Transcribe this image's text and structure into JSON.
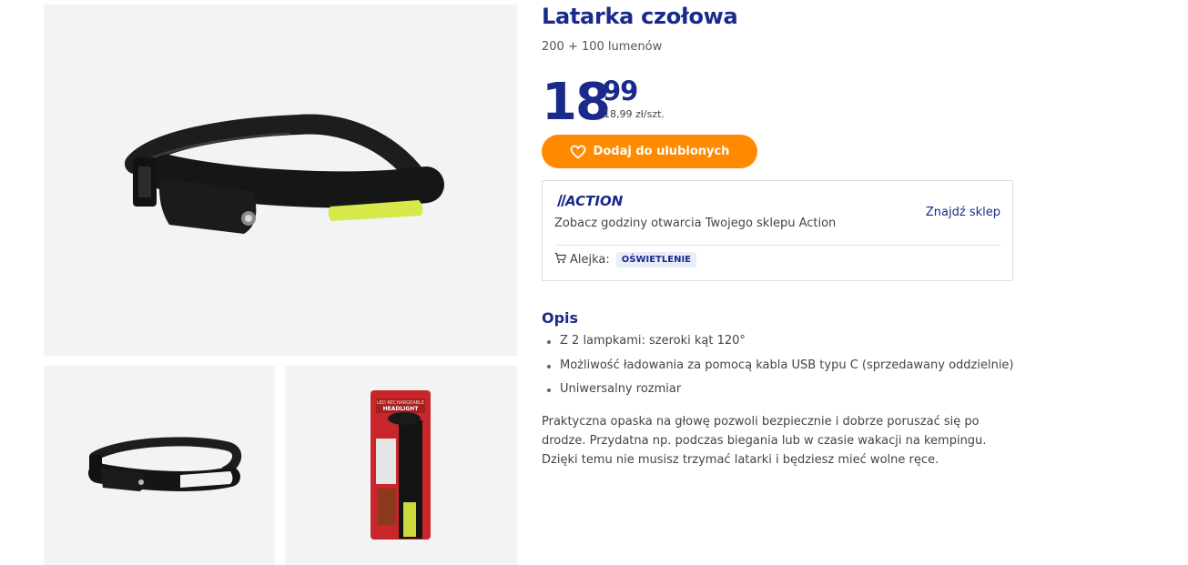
{
  "product": {
    "title": "Latarka czołowa",
    "subtitle": "200 + 100 lumenów",
    "price_int": "18",
    "price_dec": "99",
    "unit_price": "18,99 zł/szt.",
    "favorite_label": "Dodaj do ulubionych"
  },
  "store": {
    "logo_text": "ACTION",
    "text": "Zobacz godziny otwarcia Twojego sklepu Action",
    "find_label": "Znajdź sklep",
    "aisle_label": "Alejka:",
    "aisle_value": "OŚWIETLENIE"
  },
  "description": {
    "heading": "Opis",
    "features": [
      "Z 2 lampkami: szeroki kąt 120°",
      "Możliwość ładowania za pomocą kabla USB typu C (sprzedawany oddzielnie)",
      "Uniwersalny rozmiar"
    ],
    "paragraph": "Praktyczna opaska na głowę pozwoli bezpiecznie i dobrze poruszać się po drodze. Przydatna np. podczas biegania lub w czasie wakacji na kempingu. Dzięki temu nie musisz trzymać latarki i będziesz mieć wolne ręce."
  },
  "packaging": {
    "line1": "LED RECHARGEABLE",
    "line2": "HEADLIGHT"
  },
  "colors": {
    "brand_blue": "#1a2a8c",
    "accent_orange": "#ff8a00",
    "image_bg": "#f2f3f5"
  },
  "icons": [
    "heart-icon",
    "cart-icon"
  ]
}
